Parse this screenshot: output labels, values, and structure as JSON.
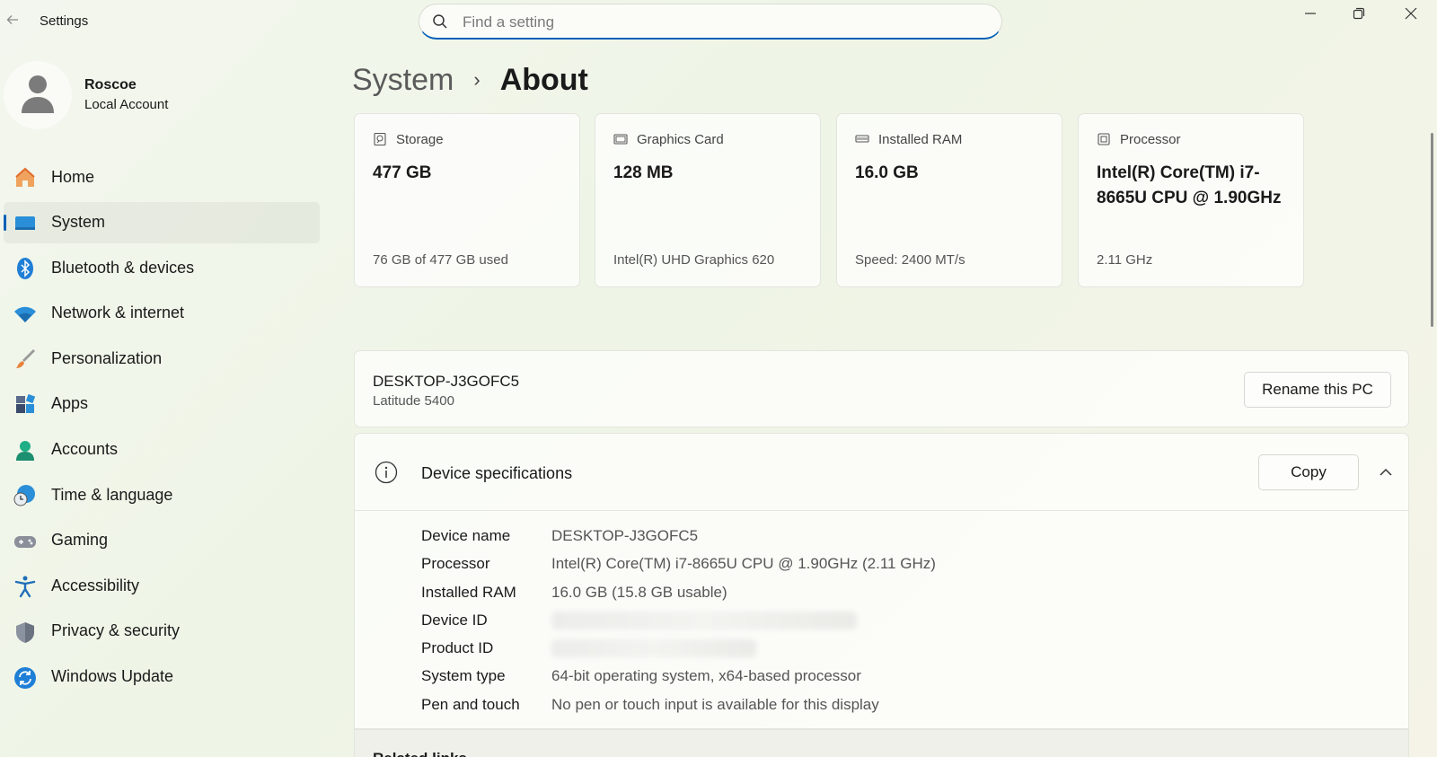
{
  "app": {
    "title": "Settings",
    "search_placeholder": "Find a setting"
  },
  "user": {
    "name": "Roscoe",
    "account_type": "Local Account"
  },
  "nav": {
    "items": [
      {
        "label": "Home",
        "icon": "home-icon"
      },
      {
        "label": "System",
        "icon": "system-icon",
        "active": true
      },
      {
        "label": "Bluetooth & devices",
        "icon": "bluetooth-icon"
      },
      {
        "label": "Network & internet",
        "icon": "wifi-icon"
      },
      {
        "label": "Personalization",
        "icon": "brush-icon"
      },
      {
        "label": "Apps",
        "icon": "apps-icon"
      },
      {
        "label": "Accounts",
        "icon": "accounts-icon"
      },
      {
        "label": "Time & language",
        "icon": "clock-globe-icon"
      },
      {
        "label": "Gaming",
        "icon": "gamepad-icon"
      },
      {
        "label": "Accessibility",
        "icon": "accessibility-icon"
      },
      {
        "label": "Privacy & security",
        "icon": "shield-icon"
      },
      {
        "label": "Windows Update",
        "icon": "update-icon"
      }
    ]
  },
  "breadcrumb": {
    "parent": "System",
    "separator": "›",
    "current": "About"
  },
  "cards": [
    {
      "title": "Storage",
      "value": "477 GB",
      "sub": "76 GB of 477 GB used",
      "icon": "storage-icon"
    },
    {
      "title": "Graphics Card",
      "value": "128 MB",
      "sub": "Intel(R) UHD Graphics 620",
      "icon": "graphics-card-icon"
    },
    {
      "title": "Installed RAM",
      "value": "16.0 GB",
      "sub": "Speed: 2400 MT/s",
      "icon": "ram-icon"
    },
    {
      "title": "Processor",
      "value": "Intel(R) Core(TM) i7-8665U CPU @ 1.90GHz",
      "sub": "2.11 GHz",
      "icon": "processor-icon"
    }
  ],
  "pc": {
    "name": "DESKTOP-J3GOFC5",
    "model": "Latitude 5400",
    "rename_label": "Rename this PC"
  },
  "specs": {
    "title": "Device specifications",
    "copy_label": "Copy",
    "rows": [
      {
        "label": "Device name",
        "value": "DESKTOP-J3GOFC5"
      },
      {
        "label": "Processor",
        "value": "Intel(R) Core(TM) i7-8665U CPU @ 1.90GHz (2.11 GHz)"
      },
      {
        "label": "Installed RAM",
        "value": "16.0 GB (15.8 GB usable)"
      },
      {
        "label": "Device ID",
        "value": ""
      },
      {
        "label": "Product ID",
        "value": ""
      },
      {
        "label": "System type",
        "value": "64-bit operating system, x64-based processor"
      },
      {
        "label": "Pen and touch",
        "value": "No pen or touch input is available for this display"
      }
    ]
  },
  "related": {
    "label": "Related links"
  },
  "colors": {
    "accent": "#005fb8"
  }
}
